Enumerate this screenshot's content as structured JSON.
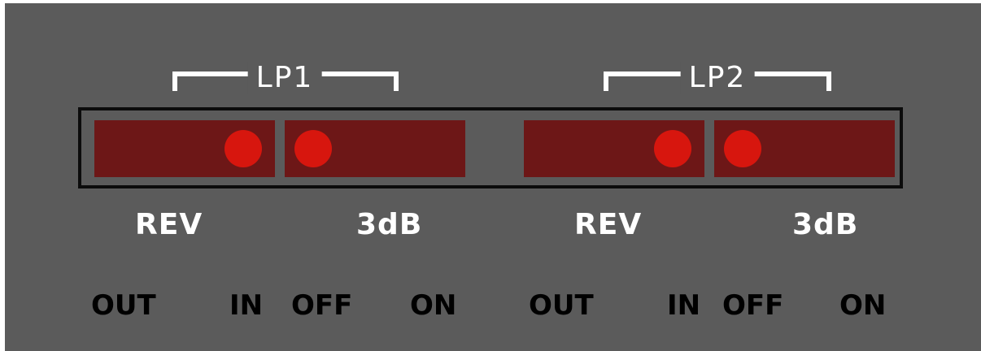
{
  "groups": [
    {
      "title": "LP1",
      "switches": [
        {
          "name": "REV",
          "off_label": "OUT",
          "on_label": "IN",
          "state": "IN"
        },
        {
          "name": "3dB",
          "off_label": "OFF",
          "on_label": "ON",
          "state": "OFF"
        }
      ]
    },
    {
      "title": "LP2",
      "switches": [
        {
          "name": "REV",
          "off_label": "OUT",
          "on_label": "IN",
          "state": "IN"
        },
        {
          "name": "3dB",
          "off_label": "OFF",
          "on_label": "ON",
          "state": "OFF"
        }
      ]
    }
  ],
  "colors": {
    "panel": "#5b5b5b",
    "switch_body": "#6d1717",
    "led": "#d7160e",
    "frame": "#0c0c0c",
    "label": "#ffffff",
    "position_label": "#000000"
  }
}
